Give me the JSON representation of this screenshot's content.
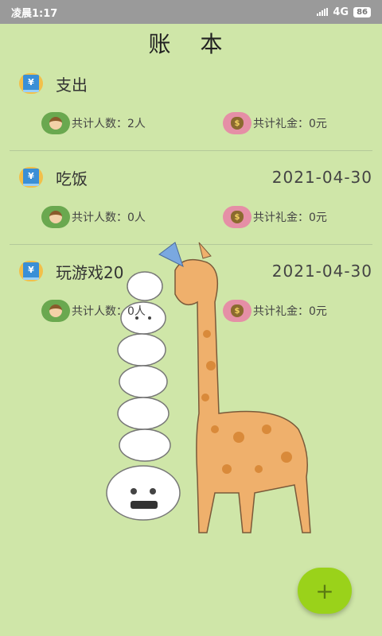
{
  "status_bar": {
    "time": "凌晨1:17",
    "network": "4G",
    "battery": "86"
  },
  "header": {
    "title": "账 本"
  },
  "books": [
    {
      "name": "支出",
      "date": "",
      "people_label": "共计人数：2人",
      "money_label": "共计礼金：0元"
    },
    {
      "name": "吃饭",
      "date": "2021-04-30",
      "people_label": "共计人数：0人",
      "money_label": "共计礼金：0元"
    },
    {
      "name": "玩游戏20",
      "date": "2021-04-30",
      "people_label": "共计人数：0人",
      "money_label": "共计礼金：0元"
    }
  ],
  "fab": {
    "icon": "plus-icon",
    "label": "+"
  },
  "colors": {
    "background": "#cfe6a8",
    "accent": "#9ad21a"
  }
}
